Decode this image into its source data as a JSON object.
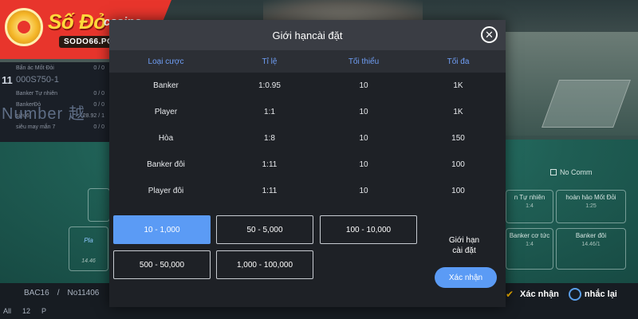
{
  "logo": {
    "brand": "Số Đỏ",
    "brand_suffix": "casino",
    "domain": "SODO66.POKER",
    "colors": {
      "background": "#e8352c",
      "brand_text": "#ffd93b"
    }
  },
  "background": {
    "stats": {
      "row1": {
        "label": "Bẩn ác Mốt Đỏi",
        "value": "0 / 0"
      },
      "row2": {
        "label": "Banker Tự nhiên",
        "value": "0 / 0"
      },
      "row3": {
        "label": "BankerĐỏ",
        "value": "0 / 0"
      },
      "row4": {
        "label": "siêu6",
        "value": "28.92 / 1"
      },
      "row5": {
        "label": "siêu may mắn 7",
        "value": "0 / 0"
      },
      "number": "11",
      "code": "000S750-1",
      "big_text": "Number 越"
    },
    "no_comm": "No Comm",
    "bet_areas": {
      "a1": {
        "label": "n Tự nhiên",
        "sub": "1:4"
      },
      "a2": {
        "label": "hoàn hảo Mốt Đỏi",
        "sub": "1:25"
      },
      "a3": {
        "label": "Banker cơ tức",
        "sub": "1:4"
      },
      "a4": {
        "label": "Banker đôi",
        "sub": "14.46/1"
      },
      "left": {
        "label": "Pla",
        "sub": "14.46"
      }
    },
    "bottom_left": {
      "table": "BAC16",
      "sep": "/",
      "round": "No11406"
    },
    "bottom_left2": {
      "a": "All",
      "b": "12",
      "c": "P"
    },
    "bottom_right": {
      "confirm": "Xác nhận",
      "repeat": "nhắc lại"
    }
  },
  "modal": {
    "title": "Giới hạncài đặt",
    "close_icon": "close-circle-icon",
    "columns": [
      "Loại cược",
      "Tỉ lệ",
      "Tối thiểu",
      "Tối đa"
    ],
    "rows": [
      {
        "type": "Banker",
        "ratio": "1:0.95",
        "min": "10",
        "max": "1K"
      },
      {
        "type": "Player",
        "ratio": "1:1",
        "min": "10",
        "max": "1K"
      },
      {
        "type": "Hòa",
        "ratio": "1:8",
        "min": "10",
        "max": "150"
      },
      {
        "type": "Banker đôi",
        "ratio": "1:11",
        "min": "10",
        "max": "100"
      },
      {
        "type": "Player đôi",
        "ratio": "1:11",
        "min": "10",
        "max": "100"
      }
    ],
    "limits": [
      {
        "label": "10 - 1,000",
        "selected": true
      },
      {
        "label": "50 - 5,000",
        "selected": false
      },
      {
        "label": "100 - 10,000",
        "selected": false
      },
      {
        "label": "500 - 50,000",
        "selected": false
      },
      {
        "label": "1,000 - 100,000",
        "selected": false
      }
    ],
    "limit_label_line1": "Giới hạn",
    "limit_label_line2": "cài đặt",
    "confirm": "Xác nhận",
    "colors": {
      "accent": "#5b9bf5",
      "header_bg": "#3a3d44",
      "panel_bg": "#1e2126"
    }
  }
}
